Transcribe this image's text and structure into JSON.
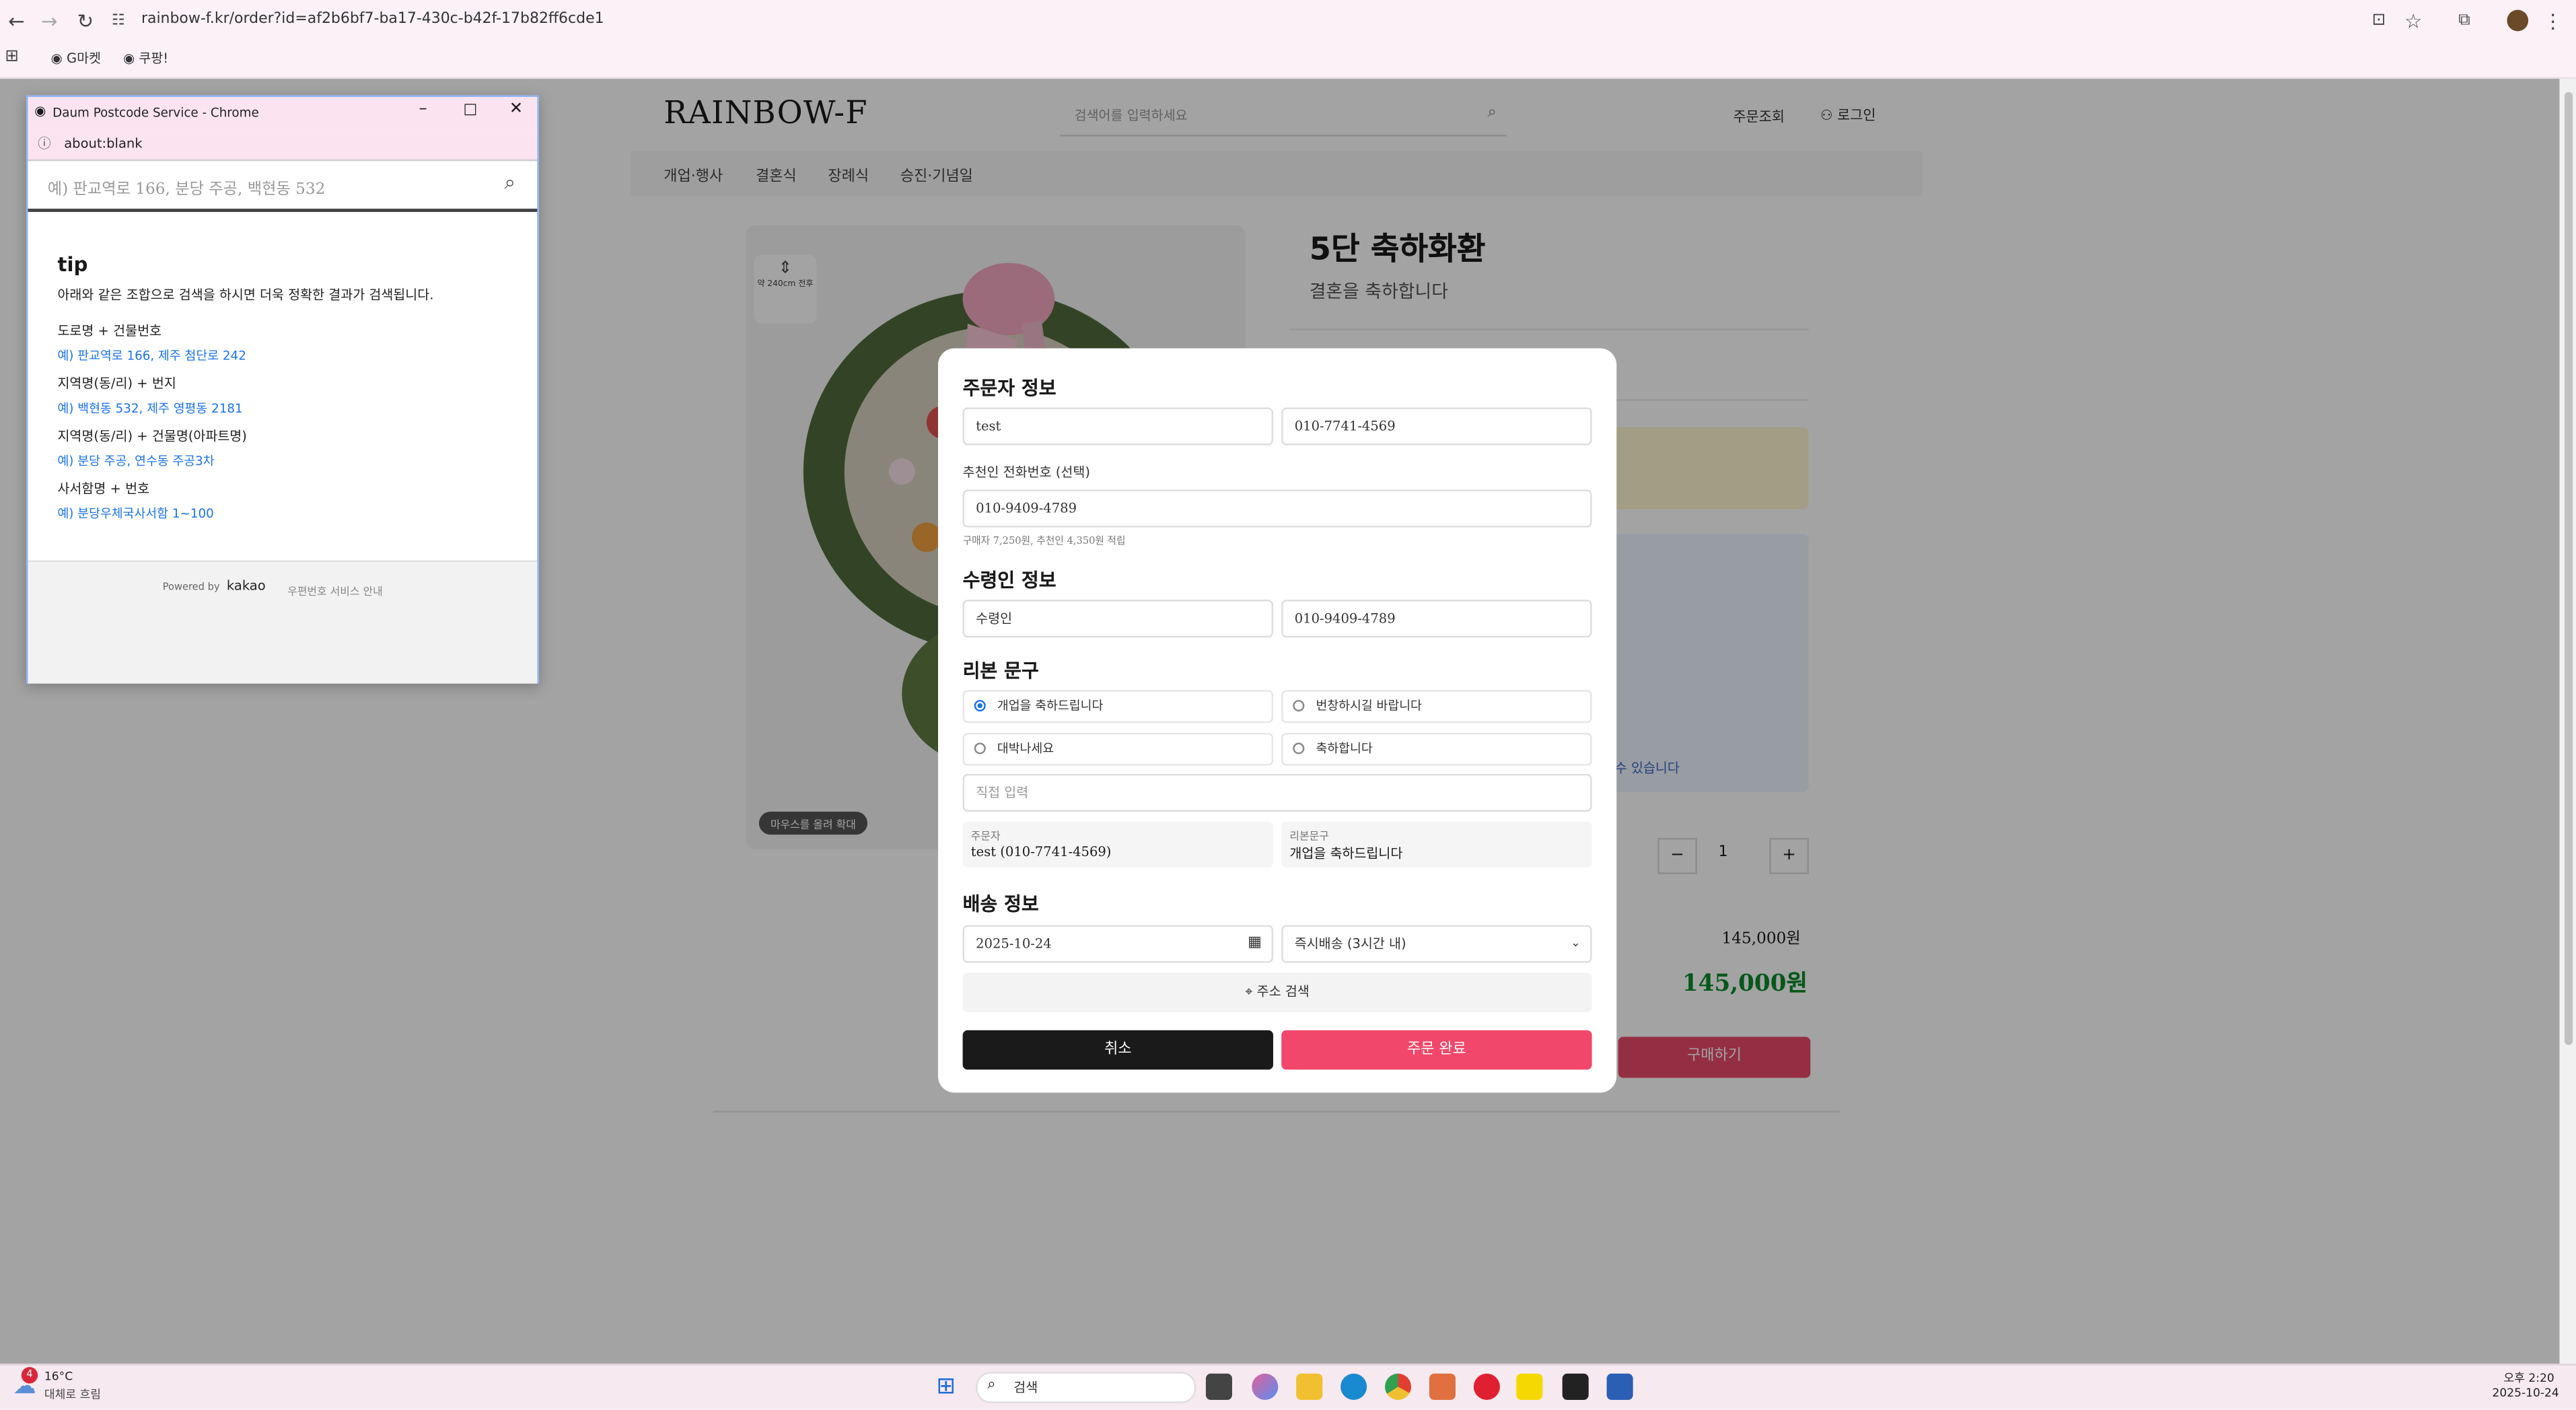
{
  "browser": {
    "url": "rainbow-f.kr/order?id=af2b6bf7-ba17-430c-b42f-17b82ff6cde1",
    "bookmarks": [
      "G마켓",
      "쿠팡!"
    ]
  },
  "site": {
    "logo": "RAINBOW-F",
    "search_placeholder": "검색어를 입력하세요",
    "header_links": [
      "주문조회",
      "로그인"
    ],
    "nav": [
      "개업·행사",
      "결혼식",
      "장례식",
      "승진·기념일"
    ]
  },
  "product": {
    "title": "5단 축하화환",
    "subtitle": "결혼을 축하합니다",
    "height_label": "약 240cm 전후",
    "zoom_hint": "마우스를 올려 확대",
    "qty": "1",
    "price": "145,000원",
    "total": "145,000원",
    "buy_label": "구매하기",
    "notice_fragment": "수 있습니다"
  },
  "modal": {
    "orderer_title": "주문자 정보",
    "orderer_name": "test",
    "orderer_phone": "010-7741-4569",
    "referrer_label": "추천인 전화번호 (선택)",
    "referrer_phone": "010-9409-4789",
    "points_note": "구매자 7,250원, 추천인 4,350원 적립",
    "recipient_title": "수령인 정보",
    "recipient_name": "수령인",
    "recipient_phone": "010-9409-4789",
    "ribbon_title": "리본 문구",
    "ribbon_options": [
      "개업을 축하드립니다",
      "번창하시길 바랍니다",
      "대박나세요",
      "축하합니다"
    ],
    "ribbon_selected": "개업을 축하드립니다",
    "custom_placeholder": "직접 입력",
    "summary_orderer_key": "주문자",
    "summary_orderer_val": "test (010-7741-4569)",
    "summary_ribbon_key": "리본문구",
    "summary_ribbon_val": "개업을 축하드립니다",
    "delivery_title": "배송 정보",
    "delivery_date": "2025-10-24",
    "delivery_option": "즉시배송 (3시간 내)",
    "address_search": "주소 검색",
    "cancel": "취소",
    "complete": "주문 완료"
  },
  "popup": {
    "window_title": "Daum Postcode Service - Chrome",
    "address": "about:blank",
    "search_placeholder": "예) 판교역로 166, 분당 주공, 백현동 532",
    "tip_title": "tip",
    "tip_desc": "아래와 같은 조합으로 검색을 하시면 더욱 정확한 결과가 검색됩니다.",
    "tips": [
      {
        "label": "도로명 + 건물번호",
        "example": "예) 판교역로 166,  제주 첨단로 242"
      },
      {
        "label": "지역명(동/리) + 번지",
        "example": "예) 백현동 532,  제주 영평동 2181"
      },
      {
        "label": "지역명(동/리) + 건물명(아파트명)",
        "example": "예) 분당 주공,  연수동 주공3차"
      },
      {
        "label": "사서함명 + 번호",
        "example": "예) 분당우체국사서함 1~100"
      }
    ],
    "powered_by": "Powered by",
    "brand": "kakao",
    "service_info": "우편번호 서비스 안내"
  },
  "taskbar": {
    "weather_badge": "4",
    "temperature": "16°C",
    "weather_desc": "대체로 흐림",
    "search_label": "검색",
    "time": "오후 2:20",
    "date": "2025-10-24"
  }
}
